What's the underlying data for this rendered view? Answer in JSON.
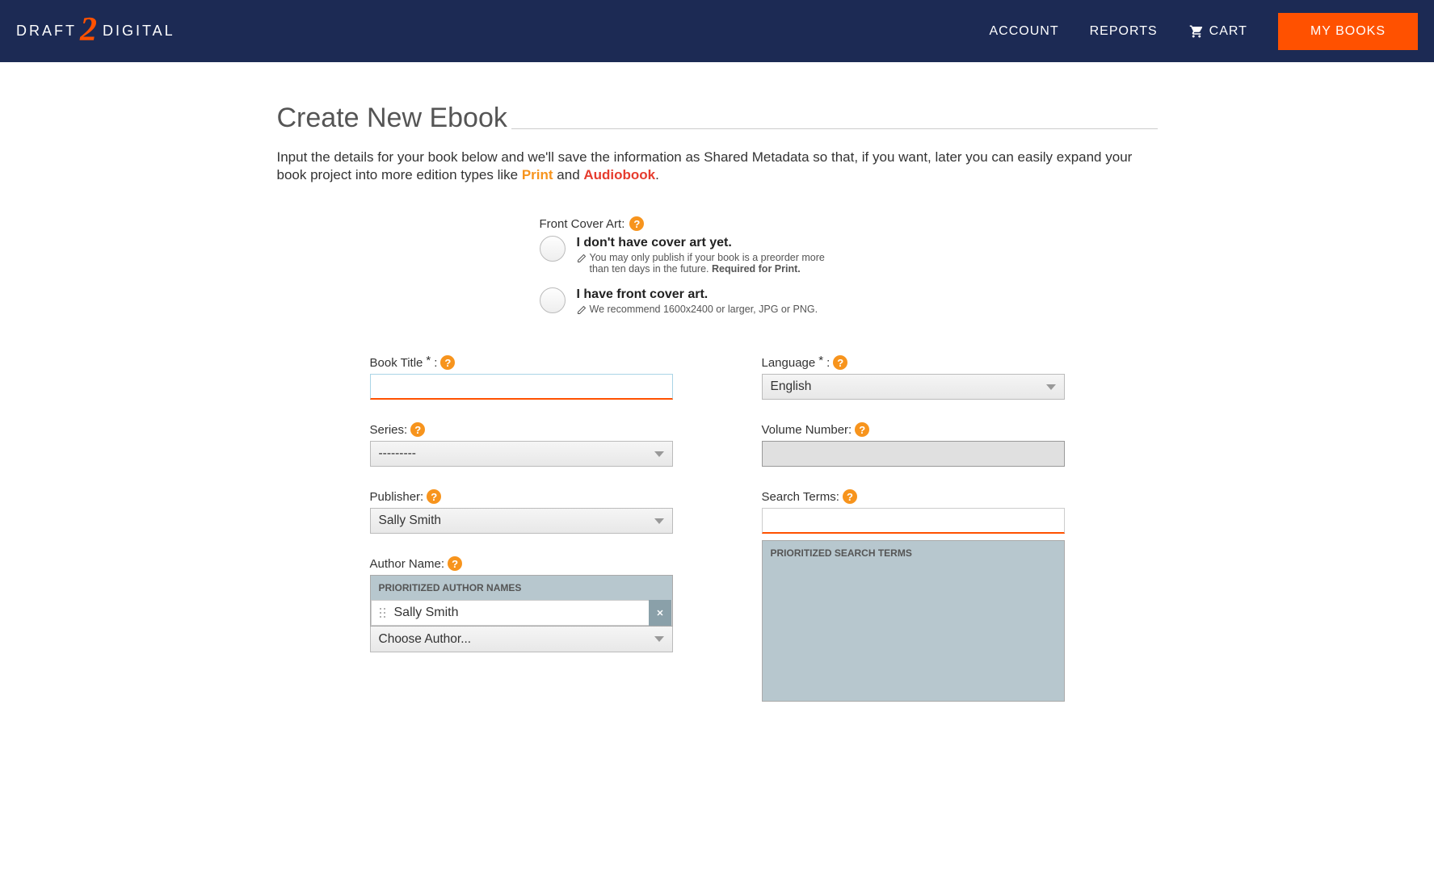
{
  "header": {
    "logo_left": "DRAFT",
    "logo_right": "DIGITAL",
    "logo_number": "2",
    "nav": {
      "account": "ACCOUNT",
      "reports": "REPORTS",
      "cart": "CART",
      "my_books": "MY BOOKS"
    }
  },
  "page": {
    "title": "Create New Ebook",
    "intro_1": "Input the details for your book below and we'll save the information as Shared Metadata so that, if you want, later you can easily expand your book project into more edition types like ",
    "intro_print": "Print",
    "intro_and": " and ",
    "intro_audio": "Audiobook",
    "intro_end": "."
  },
  "cover": {
    "label": "Front Cover Art:",
    "no_art": {
      "title": "I don't have cover art yet.",
      "desc_plain": "You may only publish if your book is a preorder more than ten days in the future. ",
      "desc_bold": "Required for Print."
    },
    "have_art": {
      "title": "I have front cover art.",
      "desc": "We recommend 1600x2400 or larger, JPG or PNG."
    }
  },
  "form": {
    "book_title": {
      "label": "Book Title",
      "value": ""
    },
    "language": {
      "label": "Language",
      "value": "English"
    },
    "series": {
      "label": "Series:",
      "value": "---------"
    },
    "volume": {
      "label": "Volume Number:"
    },
    "publisher": {
      "label": "Publisher:",
      "value": "Sally Smith"
    },
    "search_terms": {
      "label": "Search Terms:",
      "header": "PRIORITIZED SEARCH TERMS"
    },
    "author": {
      "label": "Author Name:",
      "header": "PRIORITIZED AUTHOR NAMES",
      "chip": "Sally Smith",
      "choose": "Choose Author..."
    }
  }
}
